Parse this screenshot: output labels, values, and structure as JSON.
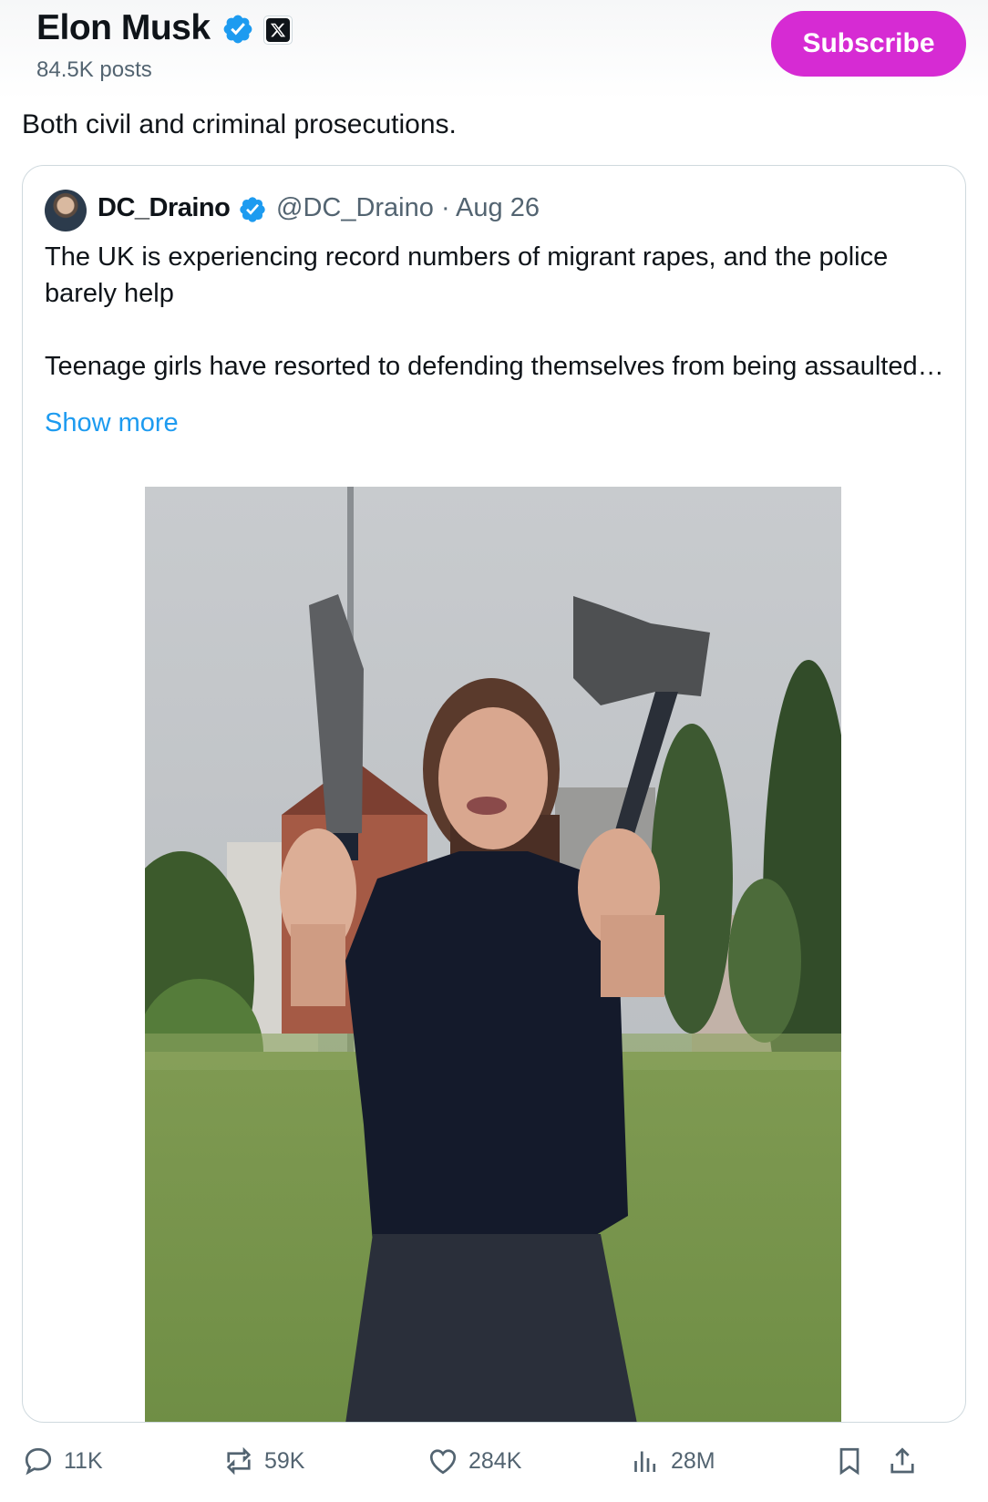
{
  "header": {
    "author_name": "Elon Musk",
    "posts_count": "84.5K posts",
    "subscribe_label": "Subscribe"
  },
  "post": {
    "text": "Both civil and criminal prosecutions."
  },
  "quote": {
    "name": "DC_Draino",
    "handle_date": "@DC_Draino · Aug 26",
    "text_1": "The UK is experiencing record numbers of migrant rapes, and the police barely help",
    "text_2": "Teenage girls have resorted to defending themselves from being assaulted…",
    "show_more": "Show more"
  },
  "actions": {
    "replies": "11K",
    "reposts": "59K",
    "likes": "284K",
    "views": "28M"
  },
  "colors": {
    "subscribe_bg": "#d62bd3",
    "verified_blue": "#1d9bf0",
    "link_blue": "#1d9bf0",
    "muted_text": "#536471"
  },
  "icons": [
    "verified-badge-icon",
    "x-affiliate-icon",
    "reply-icon",
    "repost-icon",
    "like-icon",
    "views-icon",
    "bookmark-icon",
    "share-icon"
  ]
}
